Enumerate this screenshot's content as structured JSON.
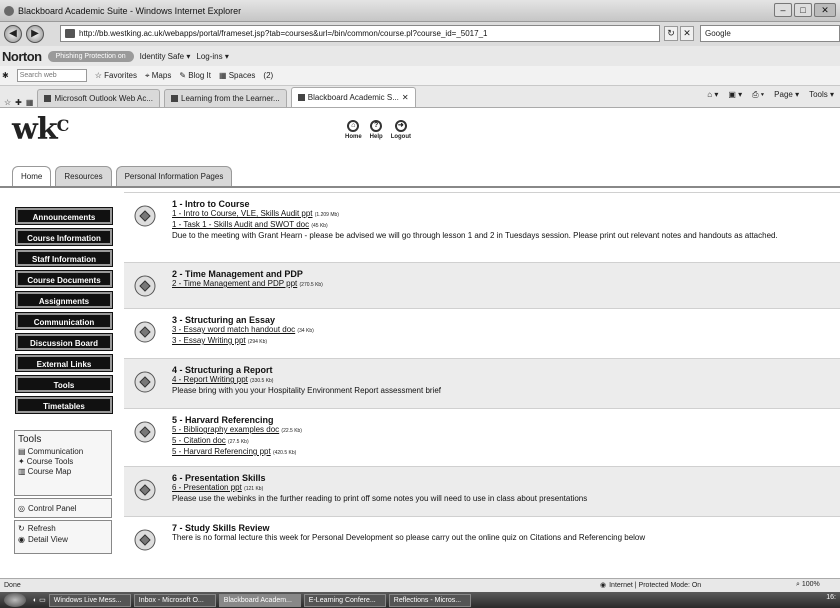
{
  "window": {
    "title": "Blackboard Academic Suite - Windows Internet Explorer"
  },
  "browser": {
    "url": "http://bb.westking.ac.uk/webapps/portal/frameset.jsp?tab=courses&url=/bin/common/course.pl?course_id=_5017_1",
    "search_placeholder": "Google",
    "norton": {
      "brand": "Norton",
      "phishing": "Phishing Protection on",
      "identity": "Identity Safe ▾",
      "login": "Log-ins ▾"
    },
    "toolbar": {
      "search_placeholder": "Search web",
      "favorites": "Favorites",
      "maps": "Maps",
      "blog": "Blog It",
      "spaces": "Spaces",
      "count": "(2)"
    },
    "tabs": [
      {
        "label": "Microsoft Outlook Web Ac..."
      },
      {
        "label": "Learning from the Learner..."
      },
      {
        "label": "Blackboard Academic S..."
      }
    ],
    "page_menu": "Page ▾",
    "tools_menu": "Tools ▾"
  },
  "site": {
    "logo": "wk",
    "logo_mark": "C",
    "topnav": [
      {
        "label": "Home",
        "icon": "home-icon"
      },
      {
        "label": "Help",
        "icon": "help-icon"
      },
      {
        "label": "Logout",
        "icon": "logout-icon"
      }
    ],
    "tabs": [
      "Home",
      "Resources",
      "Personal Information Pages"
    ]
  },
  "menu": [
    "Announcements",
    "Course Information",
    "Staff Information",
    "Course Documents",
    "Assignments",
    "Communication",
    "Discussion Board",
    "External Links",
    "Tools",
    "Timetables"
  ],
  "toolbox": {
    "heading": "Tools",
    "items": [
      "Communication",
      "Course Tools",
      "Course Map"
    ]
  },
  "control_panel": "Control Panel",
  "refresh": "Refresh",
  "detail_view": "Detail View",
  "lessons": [
    {
      "title": "1 - Intro to Course",
      "links": [
        {
          "text": "1 - Intro to Course, VLE, Skills Audit ppt",
          "size": "(1.209 Mb)"
        },
        {
          "text": "1 - Task 1 - Skills Audit and SWOT doc",
          "size": "(45 Kb)"
        }
      ],
      "note": "Due to the meeting with Grant Hearn - please be advised we will go through lesson 1 and 2 in Tuesdays session. Please print out relevant notes and handouts as attached."
    },
    {
      "title": "2 - Time Management and PDP",
      "links": [
        {
          "text": "2 - Time Management and PDP ppt",
          "size": "(270.5 Kb)"
        }
      ],
      "note": ""
    },
    {
      "title": "3 - Structuring an Essay",
      "links": [
        {
          "text": "3 - Essay word match handout doc",
          "size": "(34 Kb)"
        },
        {
          "text": "3 - Essay Writing ppt",
          "size": "(294 Kb)"
        }
      ],
      "note": ""
    },
    {
      "title": "4 - Structuring a Report",
      "links": [
        {
          "text": "4 - Report Writing ppt",
          "size": "(330.5 Kb)"
        }
      ],
      "note": "Please bring with you your Hospitality Environment Report assessment brief"
    },
    {
      "title": "5 - Harvard Referencing",
      "links": [
        {
          "text": "5 - Bibliography examples doc",
          "size": "(22.5 Kb)"
        },
        {
          "text": "5 - Citation doc",
          "size": "(27.5 Kb)"
        },
        {
          "text": "5 - Harvard Referencing ppt",
          "size": "(420.5 Kb)"
        }
      ],
      "note": ""
    },
    {
      "title": "6 - Presentation Skills",
      "links": [
        {
          "text": "6 - Presentation ppt",
          "size": "(121 Kb)"
        }
      ],
      "note": "Please use the webinks in the further reading to print off some notes you will need to use in class about presentations"
    },
    {
      "title": "7 - Study Skills Review",
      "links": [],
      "note": "There is no formal lecture this week for Personal Development so please carry out the online quiz on Citations and Referencing below"
    }
  ],
  "status": {
    "text": "Done",
    "zone": "Internet | Protected Mode: On",
    "zoom": "100%"
  },
  "taskbar": {
    "items": [
      "Windows Live Mess...",
      "Inbox - Microsoft O...",
      "Blackboard Academ...",
      "E-Learning Confere...",
      "Reflections - Micros..."
    ],
    "tray": "16:"
  }
}
